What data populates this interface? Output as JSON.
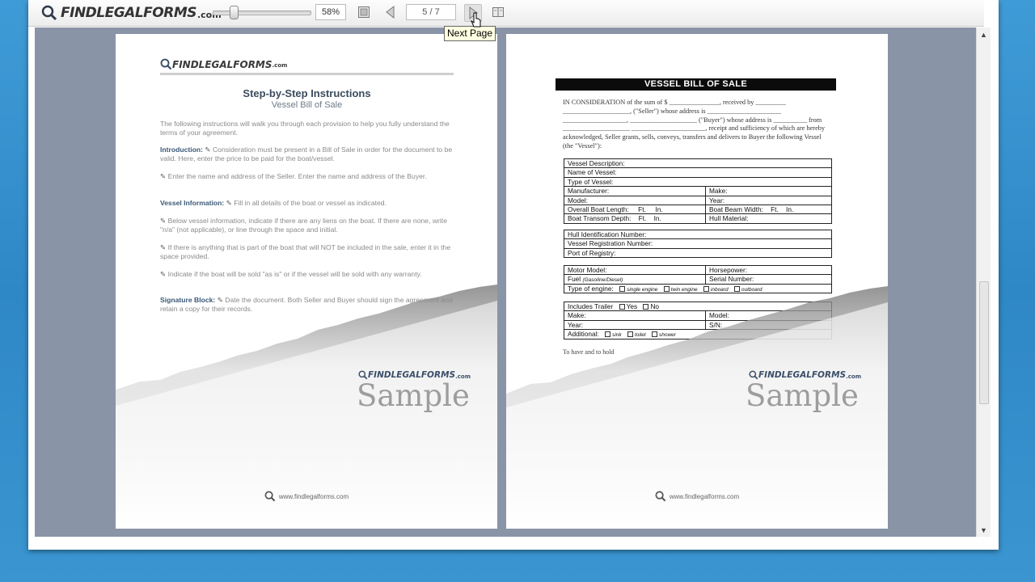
{
  "toolbar": {
    "logo_text": "FINDLEGALFORMS",
    "logo_suffix": ".com",
    "zoom_value": "58%",
    "page_indicator": "5 / 7",
    "tooltip": "Next Page"
  },
  "left_page": {
    "logo_text": "FINDLEGALFORMS",
    "logo_suffix": ".com",
    "title": "Step-by-Step Instructions",
    "subtitle": "Vessel Bill of Sale",
    "intro": "The following instructions will walk you through each provision to help you fully understand the terms of your agreement.",
    "items": [
      {
        "label": "Introduction:",
        "text": "Consideration must be present in a Bill of Sale in order for the document to be valid. Here, enter the price to be paid for the boat/vessel."
      },
      {
        "label": "",
        "text": "Enter the name and address of the Seller. Enter the name and address of the Buyer."
      },
      {
        "label": "Vessel Information:",
        "text": "Fill in all details of the boat or vessel as indicated."
      },
      {
        "label": "",
        "text": "Below vessel information, indicate if there are any liens on the boat. If there are none, write \"n/a\" (not applicable), or line through the space and initial."
      },
      {
        "label": "",
        "text": "If there is anything that is part of the boat that will NOT be included in the sale, enter it in the space provided."
      },
      {
        "label": "",
        "text": "Indicate if the boat will be sold \"as is\" or if the vessel will be sold with any warranty."
      },
      {
        "label": "Signature Block:",
        "text": "Date the document. Both Seller and Buyer should sign the agreement and retain a copy for their records."
      }
    ],
    "sample_logo": "FINDLEGALFORMS",
    "sample_logo_suffix": ".com",
    "sample_text": "Sample",
    "footer": "www.findlegalforms.com"
  },
  "right_page": {
    "title": "VESSEL BILL OF SALE",
    "intro": "IN CONSIDERATION of the sum of $ _______________, received by _________ ____________________, (\"Seller\") whose address is ______________________ ___________________, ____________________ (\"Buyer\") whose address is __________ from ____________________ ______________________, receipt and sufficiency of which are hereby acknowledged, Seller grants, sells, conveys, transfers and delivers to Buyer the following Vessel (the \"Vessel\"):",
    "vessel_rows": {
      "description": "Vessel Description:",
      "name": "Name of Vessel:",
      "type": "Type of Vessel:",
      "manufacturer": "Manufacturer:",
      "make": "Make:",
      "model": "Model:",
      "year": "Year:",
      "length": "Overall Boat Length:",
      "beam": "Boat Beam Width:",
      "transom": "Boat Transom Depth:",
      "hull_material": "Hull Material:",
      "ft": "Ft.",
      "in": "In."
    },
    "id_rows": {
      "hull_id": "Hull Identification Number:",
      "registration": "Vessel Registration Number:",
      "port": "Port of Registry:"
    },
    "motor_rows": {
      "motor_model": "Motor Model:",
      "horsepower": "Horsepower:",
      "fuel": "Fuel",
      "fuel_hint": "(Gasoline/Diesel)",
      "serial": "Serial Number:",
      "engine_type": "Type of engine:",
      "engine_options": [
        "single engine",
        "twin engine",
        "inboard",
        "outboard"
      ]
    },
    "trailer_rows": {
      "includes": "Includes Trailer",
      "yes": "Yes",
      "no": "No",
      "make": "Make:",
      "model": "Model:",
      "year": "Year:",
      "sn": "S/N:",
      "additional": "Additional:",
      "extras": [
        "sink",
        "toilet",
        "shower"
      ]
    },
    "trailing_text": "To have and to hold",
    "sample_logo": "FINDLEGALFORMS",
    "sample_logo_suffix": ".com",
    "sample_text": "Sample",
    "footer": "www.findlegalforms.com"
  },
  "colors": {
    "desktop": "#3a95d0",
    "viewer_bg": "#8a94a7",
    "accent_label": "#3b5876"
  }
}
